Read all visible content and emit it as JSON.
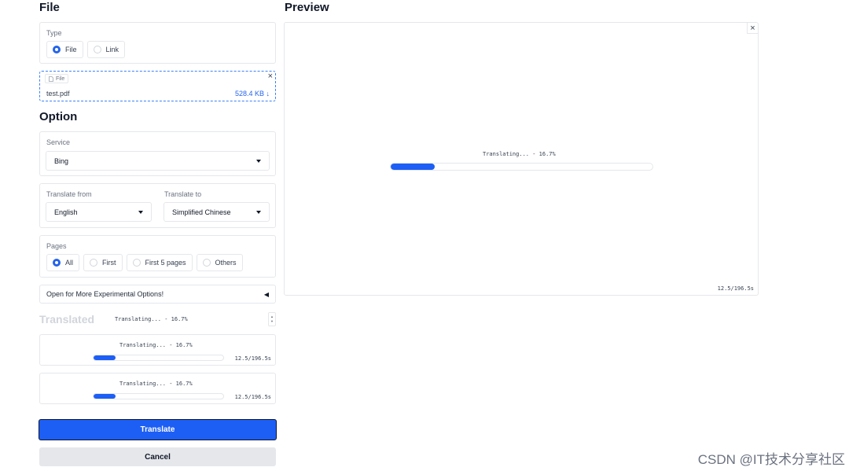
{
  "file_section": {
    "title": "File",
    "type_label": "Type",
    "type_options": [
      "File",
      "Link"
    ],
    "type_selected": "File",
    "file_chip_label": "File",
    "file_name": "test.pdf",
    "file_size": "528.4 KB ↓",
    "close_glyph": "×"
  },
  "option_section": {
    "title": "Option",
    "service_label": "Service",
    "service_value": "Bing",
    "translate_from_label": "Translate from",
    "translate_from_value": "English",
    "translate_to_label": "Translate to",
    "translate_to_value": "Simplified Chinese",
    "pages_label": "Pages",
    "pages_options": [
      "All",
      "First",
      "First 5 pages",
      "Others"
    ],
    "pages_selected": "All",
    "experimental_label": "Open for More Experimental Options!",
    "experimental_arrow": "◀"
  },
  "translated_section": {
    "title": "Translated",
    "status_text": "Translating... - 16.7%",
    "stepper_up": "▲",
    "stepper_down": "▼",
    "items": [
      {
        "status": "Translating... - 16.7%",
        "progress": 0.167,
        "time": "12.5/196.5s"
      },
      {
        "status": "Translating... - 16.7%",
        "progress": 0.167,
        "time": "12.5/196.5s"
      }
    ]
  },
  "buttons": {
    "translate": "Translate",
    "cancel": "Cancel"
  },
  "preview": {
    "title": "Preview",
    "close_glyph": "×",
    "status": "Translating... - 16.7%",
    "progress": 0.167,
    "time": "12.5/196.5s"
  },
  "watermark": "CSDN @IT技术分享社区",
  "colors": {
    "accent": "#1d5ef5",
    "button_border": "#111827",
    "cancel_bg": "#e5e7eb"
  }
}
